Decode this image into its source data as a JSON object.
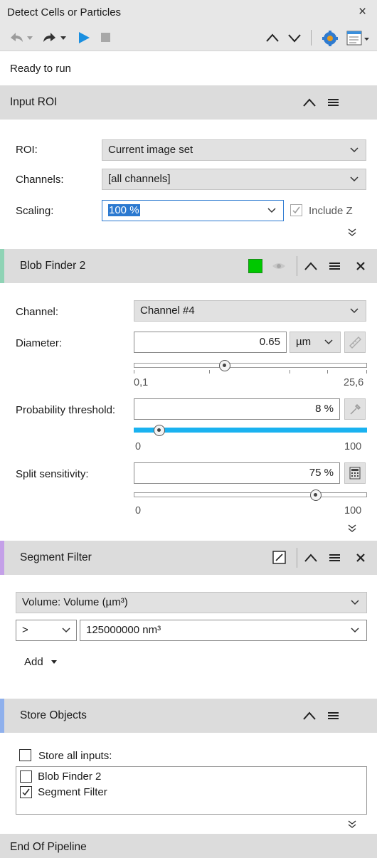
{
  "window": {
    "title": "Detect Cells or Particles",
    "close_glyph": "×"
  },
  "status": "Ready to run",
  "input_roi": {
    "title": "Input ROI",
    "roi_label": "ROI:",
    "roi_value": "Current image set",
    "channels_label": "Channels:",
    "channels_value": "[all channels]",
    "scaling_label": "Scaling:",
    "scaling_value": "100 %",
    "include_z_label": "Include Z",
    "include_z_checked": true
  },
  "blob_finder": {
    "title": "Blob Finder 2",
    "accent_color": "#8fd3b5",
    "swatch_color": "#00c800",
    "channel_label": "Channel:",
    "channel_value": "Channel #4",
    "diameter_label": "Diameter:",
    "diameter_value": "0.65",
    "diameter_unit": "µm",
    "diameter_min": "0,1",
    "diameter_max": "25,6",
    "diameter_slider_fraction": 0.36,
    "prob_label": "Probability threshold:",
    "prob_value": "8 %",
    "prob_min": "0",
    "prob_max": "100",
    "prob_slider_fraction": 0.08,
    "split_label": "Split sensitivity:",
    "split_value": "75 %",
    "split_min": "0",
    "split_max": "100",
    "split_slider_fraction": 0.75,
    "slider_fill_color": "#1ab2f0"
  },
  "segment_filter": {
    "title": "Segment Filter",
    "accent_color": "#c4a0e8",
    "feature_value": "Volume: Volume (µm³)",
    "operator_value": ">",
    "threshold_value": "125000000 nm³",
    "add_label": "Add"
  },
  "store_objects": {
    "title": "Store Objects",
    "accent_color": "#8fb0ec",
    "store_all_label": "Store all inputs:",
    "store_all_checked": false,
    "items": [
      {
        "label": "Blob Finder 2",
        "checked": false
      },
      {
        "label": "Segment Filter",
        "checked": true
      }
    ]
  },
  "end": {
    "title": "End Of Pipeline"
  },
  "icons": {
    "undo": "undo-icon",
    "redo": "redo-icon",
    "run": "play-icon",
    "stop": "stop-icon",
    "up": "chevron-up-icon",
    "down": "chevron-down-icon",
    "settings": "gear-icon",
    "layout": "view-options-icon"
  },
  "colors": {
    "accent_blue": "#1a8fe0",
    "header_bg": "#dcdcdc"
  }
}
